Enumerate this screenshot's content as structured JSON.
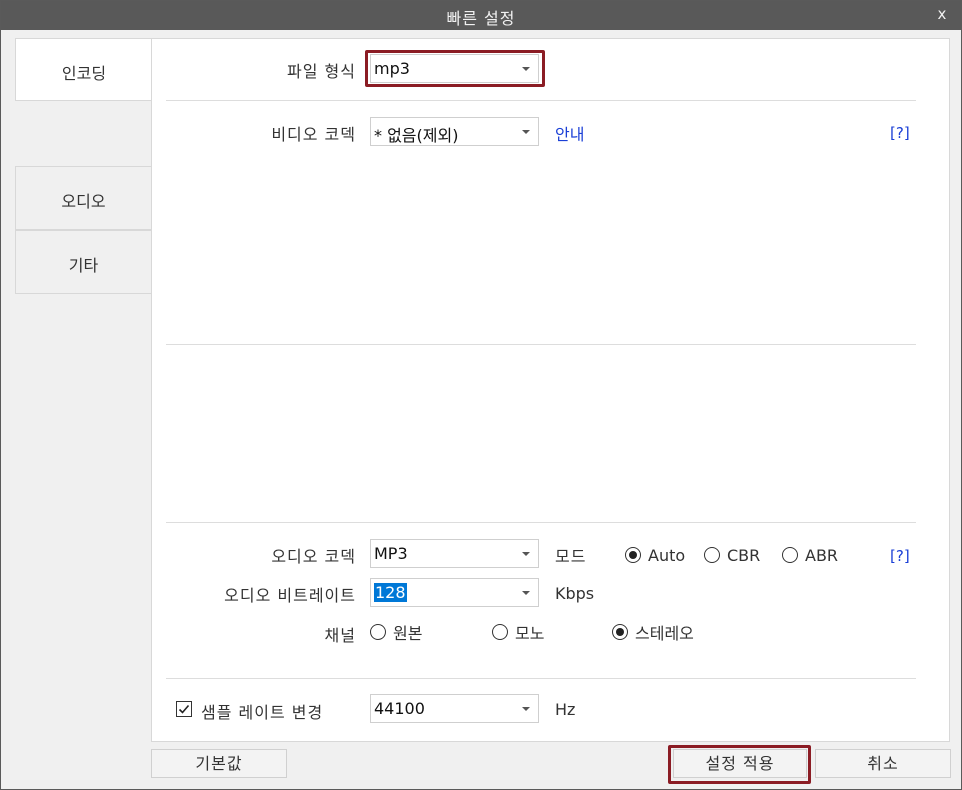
{
  "window": {
    "title": "빠른 설정",
    "close_label": "x"
  },
  "tabs": [
    {
      "label": "인코딩",
      "active": true
    },
    {
      "label": "오디오",
      "active": false
    },
    {
      "label": "기타",
      "active": false
    }
  ],
  "file_format": {
    "label": "파일 형식",
    "value": "mp3"
  },
  "video_codec": {
    "label": "비디오 코덱",
    "value": "* 없음(제외)",
    "guide_link": "안내",
    "help_link": "[?]"
  },
  "audio_codec": {
    "label": "오디오 코덱",
    "value": "MP3",
    "mode_label": "모드",
    "modes": [
      {
        "label": "Auto",
        "selected": true
      },
      {
        "label": "CBR",
        "selected": false
      },
      {
        "label": "ABR",
        "selected": false
      }
    ],
    "help_link": "[?]"
  },
  "audio_bitrate": {
    "label": "오디오 비트레이트",
    "value": "128",
    "unit": "Kbps"
  },
  "channel": {
    "label": "채널",
    "options": [
      {
        "label": "원본",
        "selected": false
      },
      {
        "label": "모노",
        "selected": false
      },
      {
        "label": "스테레오",
        "selected": true
      }
    ]
  },
  "sample_rate": {
    "checkbox_label": "샘플 레이트 변경",
    "checked": true,
    "value": "44100",
    "unit": "Hz"
  },
  "buttons": {
    "default": "기본값",
    "apply": "설정 적용",
    "cancel": "취소"
  },
  "colors": {
    "titlebar": "#595959",
    "highlight_border": "#8b1c24",
    "link": "#1a3fd6",
    "selection": "#0078d7"
  }
}
